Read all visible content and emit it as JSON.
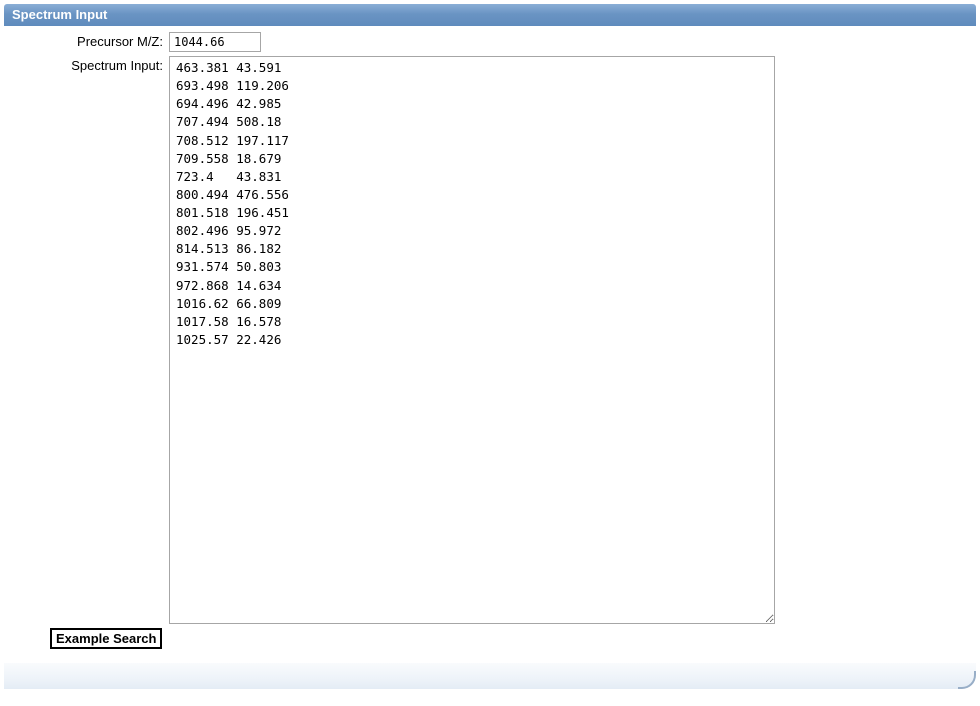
{
  "panel": {
    "title": "Spectrum Input"
  },
  "form": {
    "precursor_label": "Precursor M/Z:",
    "precursor_value": "1044.66",
    "spectrum_label": "Spectrum Input:",
    "spectrum_value": "463.381\t43.591\n693.498\t119.206\n694.496\t42.985\n707.494\t508.18\n708.512\t197.117\n709.558\t18.679\n723.4\t43.831\n800.494\t476.556\n801.518\t196.451\n802.496\t95.972\n814.513\t86.182\n931.574\t50.803\n972.868\t14.634\n1016.62\t66.809\n1017.58\t16.578\n1025.57\t22.426"
  },
  "buttons": {
    "example_search": "Example Search"
  }
}
